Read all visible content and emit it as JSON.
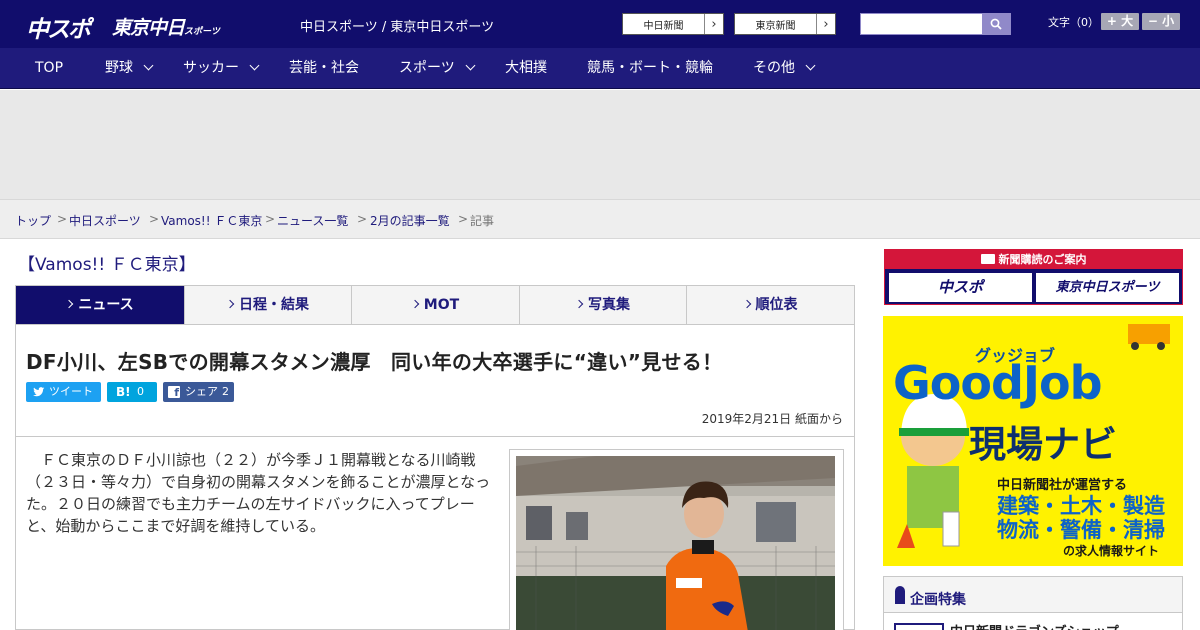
{
  "header": {
    "logo_chunichi": "中スポ",
    "logo_tokyo": "東京中日",
    "logo_tokyo_small": "スポーツ",
    "site_title": "中日スポーツ / 東京中日スポーツ",
    "newspaper_buttons": [
      "中日新聞",
      "東京新聞"
    ],
    "search_placeholder": "",
    "font_size_label": "文字（0）",
    "font_larger": "+ 大",
    "font_smaller": "− 小"
  },
  "nav": [
    {
      "label": "TOP",
      "dropdown": false
    },
    {
      "label": "野球",
      "dropdown": true
    },
    {
      "label": "サッカー",
      "dropdown": true
    },
    {
      "label": "芸能・社会",
      "dropdown": false
    },
    {
      "label": "スポーツ",
      "dropdown": true
    },
    {
      "label": "大相撲",
      "dropdown": false
    },
    {
      "label": "競馬・ボート・競輪",
      "dropdown": false
    },
    {
      "label": "その他",
      "dropdown": true
    }
  ],
  "breadcrumb": [
    "トップ",
    "中日スポーツ",
    "Vamos!! ＦＣ東京",
    "ニュース一覧",
    "2月の記事一覧",
    "記事"
  ],
  "category_title": "【Vamos!! ＦＣ東京】",
  "tabs": [
    "ニュース",
    "日程・結果",
    "MOT",
    "写真集",
    "順位表"
  ],
  "active_tab": "ニュース",
  "article": {
    "headline": "DF小川、左SBでの開幕スタメン濃厚　同い年の大卒選手に“違い”見せる！",
    "share": {
      "tweet": "ツイート",
      "hatena_count": "0",
      "facebook": "シェア",
      "facebook_count": "2"
    },
    "date": "2019年2月21日 紙面から",
    "body": "　ＦＣ東京のＤＦ小川諒也（２２）が今季Ｊ１開幕戦となる川崎戦（２３日・等々力）で自身初の開幕スタメンを飾ることが濃厚となった。２０日の練習でも主力チームの左サイドバックに入ってプレーと、始動からここまで好調を維持している。"
  },
  "sidebar": {
    "subscribe_title": "新聞購読のご案内",
    "subscribe_buttons": [
      "中スポ",
      "東京中日スポーツ"
    ],
    "ad_goodjob": {
      "kana": "グッジョブ",
      "title": "GoodJob",
      "subtitle": "現場ナビ",
      "desc1": "中日新聞社が運営する",
      "desc2": "建築・土木・製造",
      "desc3": "物流・警備・清掃",
      "desc4": "の求人情報サイト"
    },
    "feature_title": "企画特集",
    "feature_item": "中日新聞ドラゴンズショップ"
  },
  "colors": {
    "header_bg": "#110d6c",
    "nav_bg": "#1f1b7c",
    "accent_red": "#d4163a",
    "ad_yellow": "#fff200"
  }
}
